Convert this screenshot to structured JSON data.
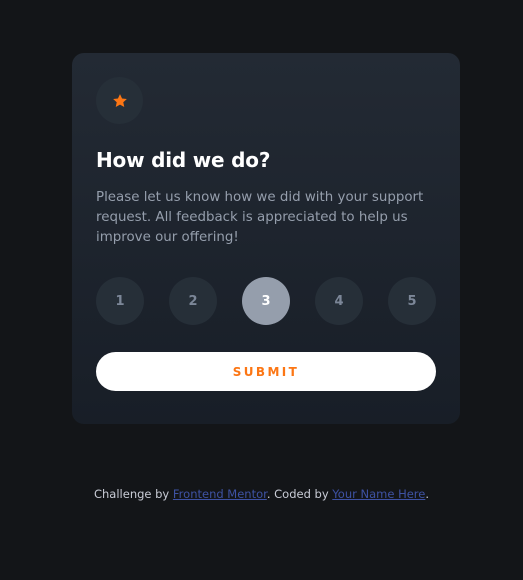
{
  "colors": {
    "page_background": "#131518",
    "card_background": "#202731",
    "accent_orange": "#fc7614",
    "muted_text": "#959eac",
    "link": "#3e52a3"
  },
  "card": {
    "icon": "star-icon",
    "title": "How did we do?",
    "description": "Please let us know how we did with your support request. All feedback is appreciated to help us improve our offering!",
    "ratings": [
      {
        "label": "1",
        "selected": false
      },
      {
        "label": "2",
        "selected": false
      },
      {
        "label": "3",
        "selected": true
      },
      {
        "label": "4",
        "selected": false
      },
      {
        "label": "5",
        "selected": false
      }
    ],
    "submit_label": "SUBMIT"
  },
  "attribution": {
    "prefix": "Challenge by ",
    "link1": "Frontend Mentor",
    "middle": ". Coded by ",
    "link2": "Your Name Here",
    "suffix": "."
  }
}
